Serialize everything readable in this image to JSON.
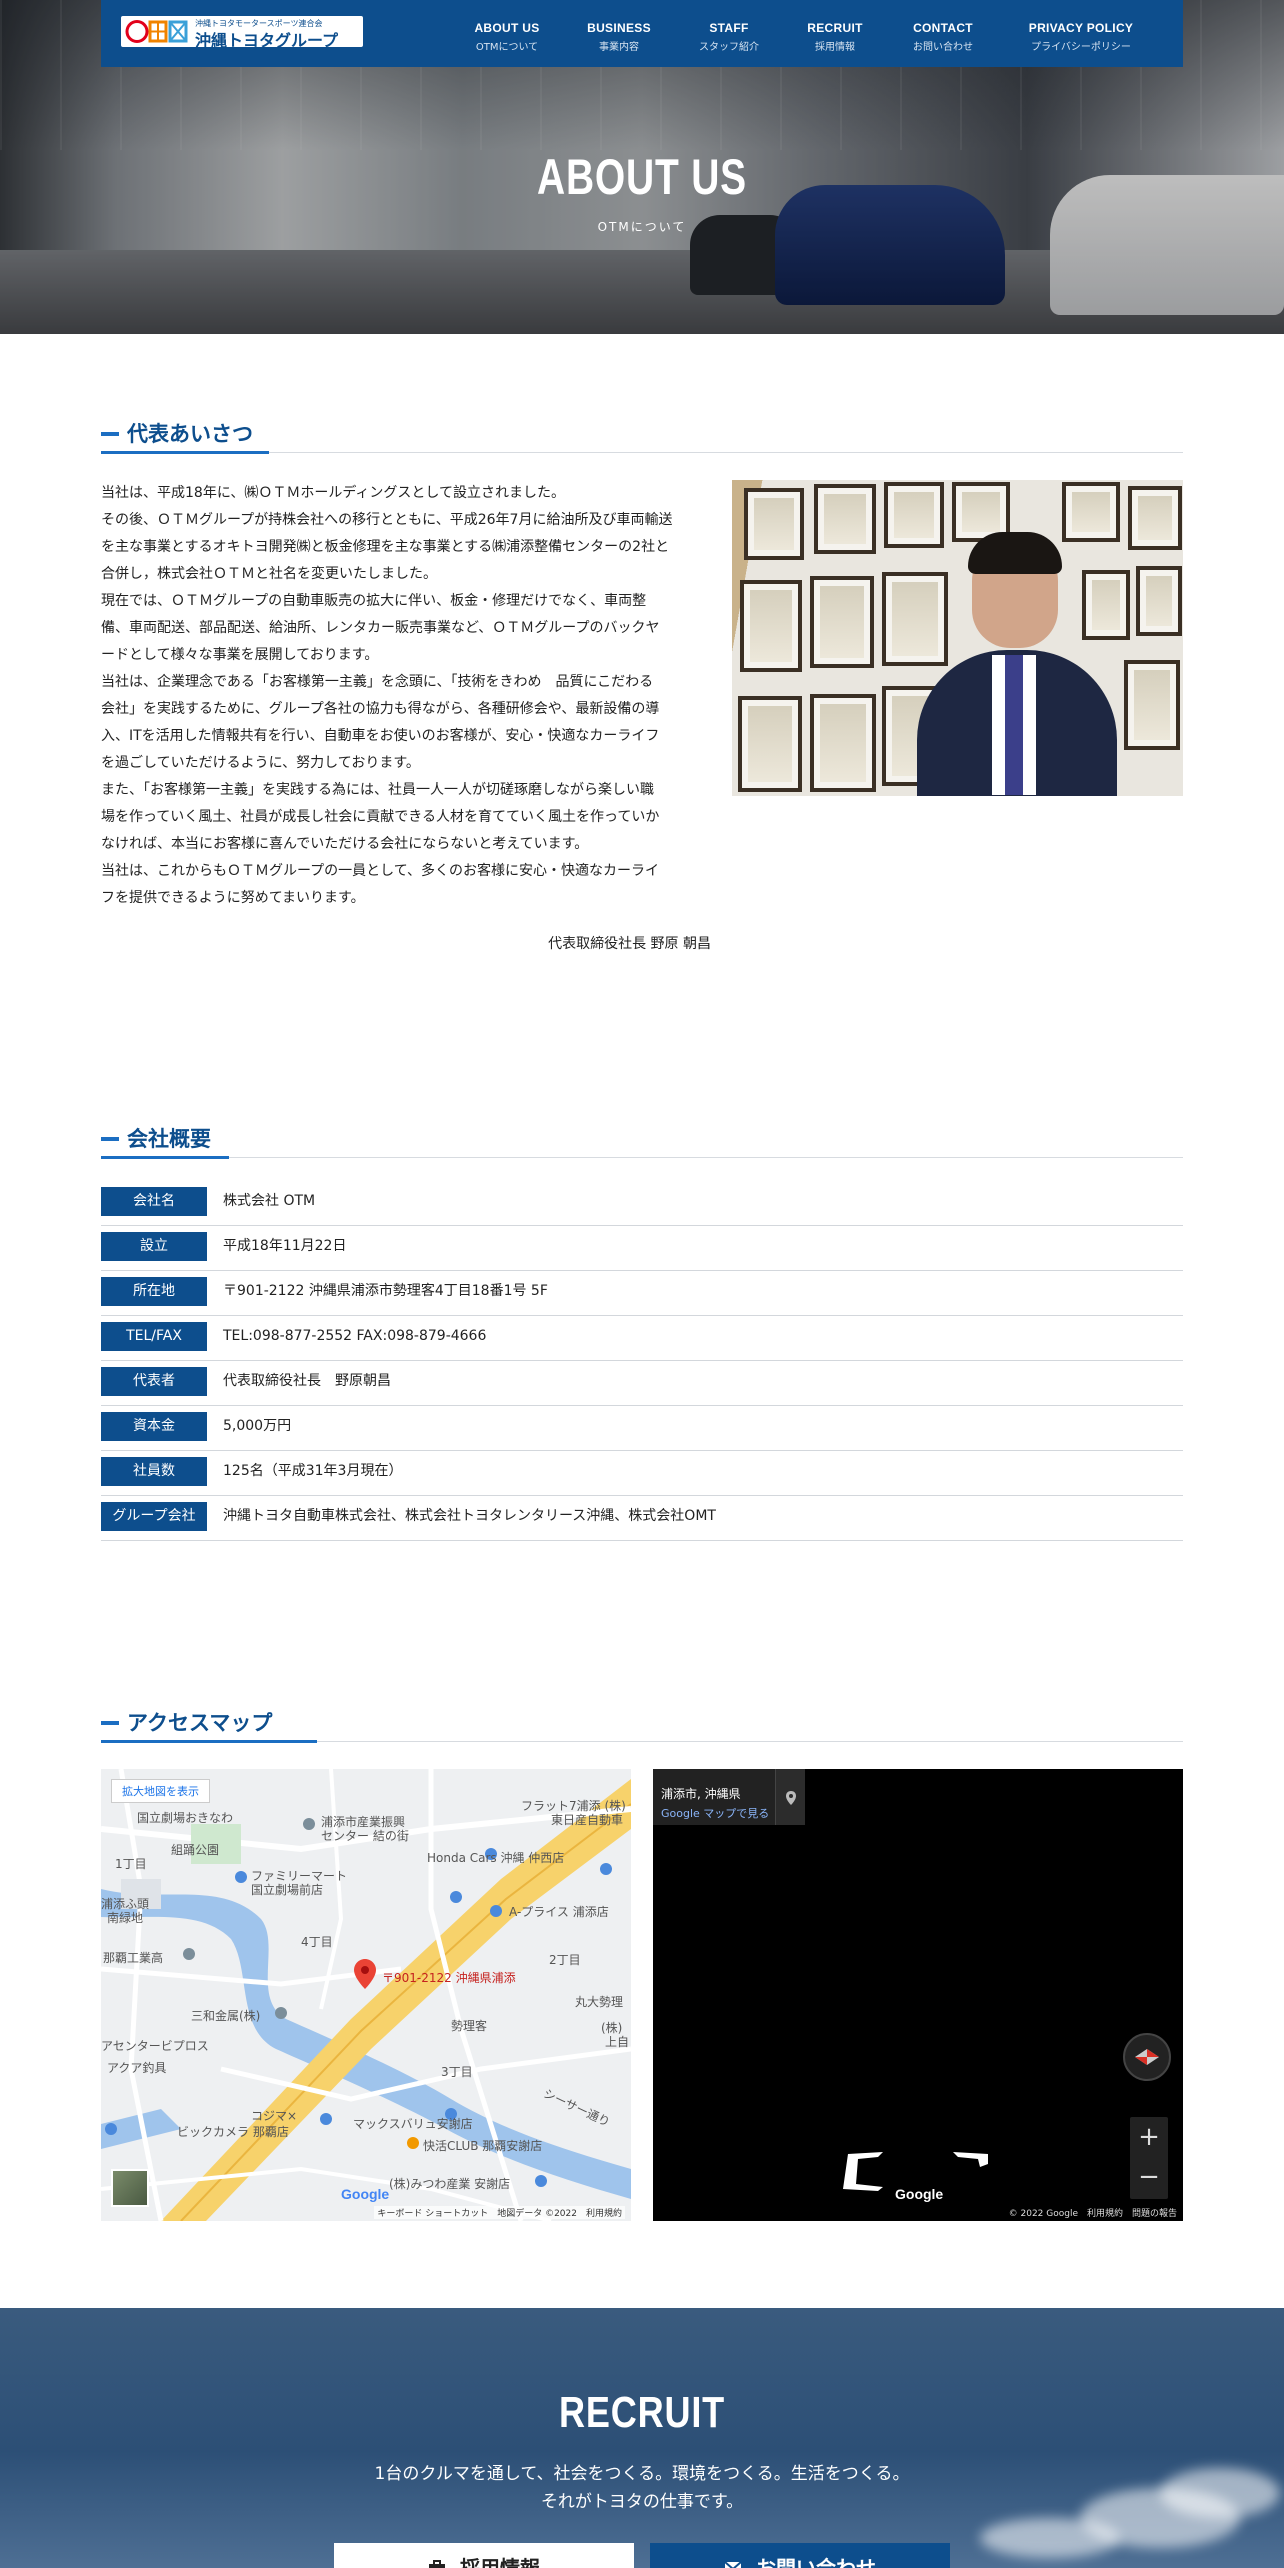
{
  "logo": {
    "tagline": "沖縄トヨタモータースポーツ連合会",
    "name": "沖縄トヨタグループ"
  },
  "nav": [
    {
      "en": "ABOUT US",
      "ja": "OTMについて"
    },
    {
      "en": "BUSINESS",
      "ja": "事業内容"
    },
    {
      "en": "STAFF",
      "ja": "スタッフ紹介"
    },
    {
      "en": "RECRUIT",
      "ja": "採用情報"
    },
    {
      "en": "CONTACT",
      "ja": "お問い合わせ"
    },
    {
      "en": "PRIVACY POLICY",
      "ja": "プライバシーポリシー"
    }
  ],
  "hero": {
    "title": "ABOUT US",
    "subtitle": "OTMについて"
  },
  "greeting": {
    "heading": "代表あいさつ",
    "lines": [
      "当社は、平成18年に、㈱ＯＴＭホールディングスとして設立されました。",
      "その後、ＯＴＭグループが持株会社への移行とともに、平成26年7月に給油所及び車両輸送",
      "を主な事業とするオキトヨ開発㈱と板金修理を主な事業とする㈱浦添整備センターの2社と",
      "合併し，株式会社ＯＴＭと社名を変更いたしました。",
      "現在では、ＯＴＭグループの自動車販売の拡大に伴い、板金・修理だけでなく、車両整",
      "備、車両配送、部品配送、給油所、レンタカー販売事業など、ＯＴＭグループのバックヤ",
      "ードとして様々な事業を展開しております。",
      "当社は、企業理念である「お客様第一主義」を念頭に、「技術をきわめ　品質にこだわる",
      "会社」を実践するために、グループ各社の協力も得ながら、各種研修会や、最新設備の導",
      "入、ITを活用した情報共有を行い、自動車をお使いのお客様が、安心・快適なカーライフ",
      "を過ごしていただけるように、努力しております。",
      "また、「お客様第一主義」を実践する為には、社員一人一人が切磋琢磨しながら楽しい職",
      "場を作っていく風土、社員が成長し社会に貢献できる人材を育てていく風土を作っていか",
      "なければ、本当にお客様に喜んでいただける会社にならないと考えています。",
      "当社は、これからもＯＴＭグループの一員として、多くのお客様に安心・快適なカーライ",
      "フを提供できるように努めてまいります。"
    ],
    "signature": "代表取締役社長 野原 朝昌"
  },
  "company": {
    "heading": "会社概要",
    "rows": [
      {
        "label": "会社名",
        "value": "株式会社 OTM"
      },
      {
        "label": "設立",
        "value": "平成18年11月22日"
      },
      {
        "label": "所在地",
        "value": "〒901-2122 沖縄県浦添市勢理客4丁目18番1号 5F"
      },
      {
        "label": "TEL/FAX",
        "value": "TEL:098-877-2552 FAX:098-879-4666"
      },
      {
        "label": "代表者",
        "value": "代表取締役社長　野原朝昌"
      },
      {
        "label": "資本金",
        "value": "5,000万円"
      },
      {
        "label": "社員数",
        "value": "125名（平成31年3月現在）"
      },
      {
        "label": "グループ会社",
        "value": "沖縄トヨタ自動車株式会社、株式会社トヨタレンタリース沖縄、株式会社OMT"
      }
    ]
  },
  "access": {
    "heading": "アクセスマップ",
    "map": {
      "enlarge": "拡大地図を表示",
      "address_pin": "〒901-2122 沖縄県浦添",
      "labels": [
        "国立劇場おきなわ",
        "浦添市産業振興",
        "センター 結の街",
        "組踊公園",
        "フラット7浦添 (株)",
        "東日産自動車",
        "ファミリーマート",
        "国立劇場前店",
        "Honda Cars 沖縄 仲西店",
        "A-プライス 浦添店",
        "浦添ふ頭",
        "南緑地",
        "1丁目",
        "4丁目",
        "2丁目",
        "丸大勢理",
        "那覇工業高",
        "三和金属(株)",
        "勢理客",
        "(株)",
        "上自",
        "アセンタービプロス",
        "アクア釣具",
        "3丁目",
        "シーサー通り",
        "コジマ×",
        "ビックカメラ 那覇店",
        "マックスバリュ安謝店",
        "快活CLUB 那覇安謝店",
        "(株)みつわ産業 安謝店"
      ],
      "footer": "キーボード ショートカット　地図データ ©2022　利用規約",
      "google": "Google"
    },
    "streetview": {
      "place": "浦添市, 沖縄県",
      "open_in_maps": "Google マップで見る",
      "zoom_in": "+",
      "zoom_out": "−",
      "footer": "© 2022 Google　利用規約　問題の報告",
      "google": "Google"
    }
  },
  "recruit": {
    "title": "RECRUIT",
    "line1": "1台のクルマを通して、社会をつくる。環境をつくる。生活をつくる。",
    "line2": "それがトヨタの仕事です。",
    "btn_jobs": "採用情報",
    "btn_contact": "お問い合わせ"
  },
  "colors": {
    "primary": "#0d4e8d",
    "accent": "#1b6ec2"
  }
}
